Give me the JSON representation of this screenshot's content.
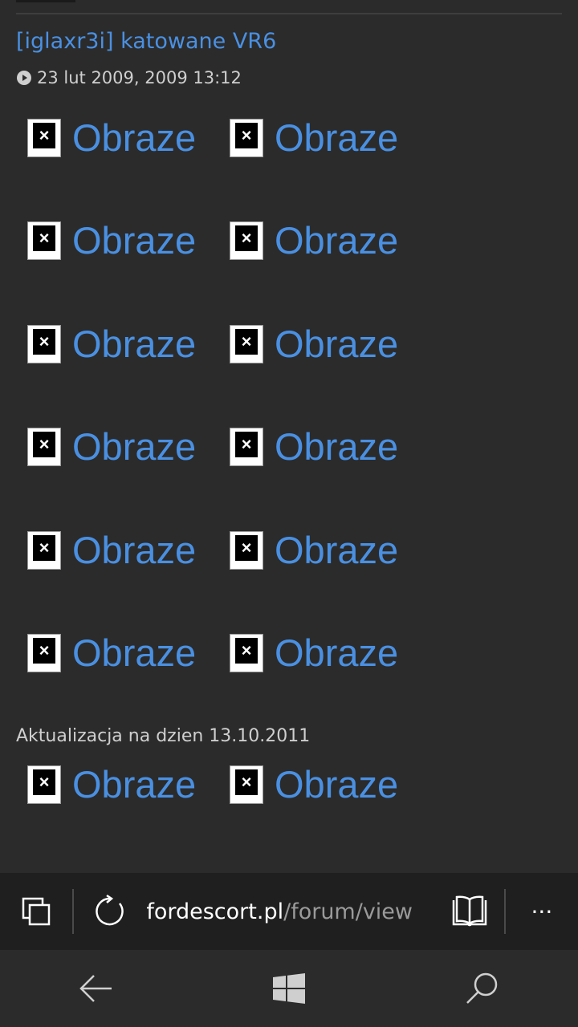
{
  "post": {
    "title": "[iglaxr3i] katowane VR6",
    "date": "23 lut 2009, 2009 13:12",
    "date_icon": "play-circle-icon"
  },
  "images": {
    "alt_text": "Obraze",
    "icon": "broken-image-icon",
    "rows_first_group": 6,
    "rows_second_group": 1,
    "per_row": 2
  },
  "update_note": "Aktualizacja na dzien 13.10.2011",
  "browser": {
    "tabs_icon": "tabs-icon",
    "refresh_icon": "refresh-icon",
    "url_host": "fordescort.pl",
    "url_path": "/forum/view",
    "reading_icon": "reading-view-icon",
    "more_icon": "more-icon",
    "more_label": "···"
  },
  "nav": {
    "back_icon": "back-arrow-icon",
    "home_icon": "windows-start-icon",
    "search_icon": "search-icon"
  },
  "colors": {
    "background": "#2b2b2b",
    "link": "#4a90e2",
    "text": "#cfcfcf",
    "bar": "#1f1f1f"
  }
}
